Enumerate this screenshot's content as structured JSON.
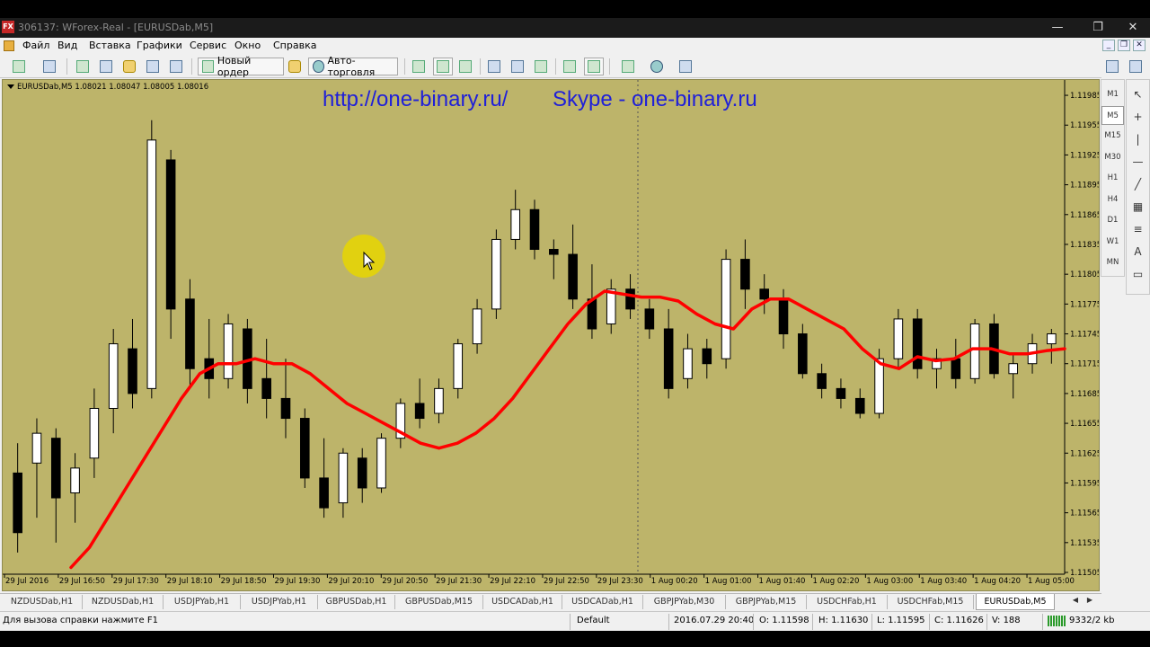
{
  "window": {
    "app_icon_text": "FX",
    "title": "306137: WForex-Real - [EURUSDab,M5]",
    "min": "—",
    "restore": "❐",
    "close": "✕"
  },
  "menu": {
    "items": [
      "Файл",
      "Вид",
      "Вставка",
      "Графики",
      "Сервис",
      "Окно",
      "Справка"
    ],
    "mdi_min": "_",
    "mdi_restore": "❐",
    "mdi_close": "✕"
  },
  "toolbar": {
    "new_order_label": "Новый ордер",
    "autotrading_label": "Авто-торговля"
  },
  "chart": {
    "header": "EURUSDab,M5  1.08021 1.08047 1.08005 1.08016",
    "watermark_left": "http://one-binary.ru/",
    "watermark_right": "Skype - one-binary.ru",
    "background_color": "#bdb46a",
    "candle_up_color": "#ffffff",
    "candle_down_color": "#000000",
    "ma_color": "#ff0000"
  },
  "chart_data": {
    "type": "candlestick",
    "symbol": "EURUSDab",
    "timeframe": "M5",
    "price_ticks": [
      "1.11985",
      "1.11955",
      "1.11925",
      "1.11895",
      "1.11865",
      "1.11835",
      "1.11805",
      "1.11775",
      "1.11745",
      "1.11715",
      "1.11685",
      "1.11655",
      "1.11625",
      "1.11595",
      "1.11565",
      "1.11535",
      "1.11505"
    ],
    "ylim": [
      1.11505,
      1.11995
    ],
    "time_ticks": [
      "29 Jul 2016",
      "29 Jul 16:50",
      "29 Jul 17:30",
      "29 Jul 18:10",
      "29 Jul 18:50",
      "29 Jul 19:30",
      "29 Jul 20:10",
      "29 Jul 20:50",
      "29 Jul 21:30",
      "29 Jul 22:10",
      "29 Jul 22:50",
      "29 Jul 23:30",
      "1 Aug 00:20",
      "1 Aug 01:00",
      "1 Aug 01:40",
      "1 Aug 02:20",
      "1 Aug 03:00",
      "1 Aug 03:40",
      "1 Aug 04:20",
      "1 Aug 05:00"
    ],
    "ma_series": {
      "name": "",
      "values": [
        1.1151,
        1.1153,
        1.1156,
        1.1159,
        1.1162,
        1.1165,
        1.1168,
        1.11705,
        1.11715,
        1.11715,
        1.1172,
        1.11715,
        1.11715,
        1.11705,
        1.1169,
        1.11675,
        1.11665,
        1.11655,
        1.11645,
        1.11635,
        1.1163,
        1.11635,
        1.11645,
        1.1166,
        1.1168,
        1.11705,
        1.1173,
        1.11755,
        1.11775,
        1.11788,
        1.11785,
        1.11782,
        1.11782,
        1.11778,
        1.11765,
        1.11755,
        1.1175,
        1.1177,
        1.1178,
        1.1178,
        1.1177,
        1.1176,
        1.1175,
        1.1173,
        1.11715,
        1.1171,
        1.11722,
        1.11718,
        1.1172,
        1.1173,
        1.1173,
        1.11725,
        1.11725,
        1.11728,
        1.1173
      ]
    },
    "candles": [
      {
        "o": 1.11605,
        "h": 1.11635,
        "l": 1.11525,
        "c": 1.11545
      },
      {
        "o": 1.11615,
        "h": 1.1166,
        "l": 1.1156,
        "c": 1.11645
      },
      {
        "o": 1.1164,
        "h": 1.1165,
        "l": 1.11535,
        "c": 1.1158
      },
      {
        "o": 1.11585,
        "h": 1.11625,
        "l": 1.11555,
        "c": 1.1161
      },
      {
        "o": 1.1162,
        "h": 1.1169,
        "l": 1.116,
        "c": 1.1167
      },
      {
        "o": 1.1167,
        "h": 1.1175,
        "l": 1.11645,
        "c": 1.11735
      },
      {
        "o": 1.1173,
        "h": 1.1176,
        "l": 1.1167,
        "c": 1.11685
      },
      {
        "o": 1.1169,
        "h": 1.1196,
        "l": 1.1168,
        "c": 1.1194
      },
      {
        "o": 1.1192,
        "h": 1.1193,
        "l": 1.1174,
        "c": 1.1177
      },
      {
        "o": 1.1178,
        "h": 1.118,
        "l": 1.1169,
        "c": 1.1171
      },
      {
        "o": 1.1172,
        "h": 1.1176,
        "l": 1.1168,
        "c": 1.117
      },
      {
        "o": 1.117,
        "h": 1.11765,
        "l": 1.1169,
        "c": 1.11755
      },
      {
        "o": 1.1175,
        "h": 1.1176,
        "l": 1.11675,
        "c": 1.1169
      },
      {
        "o": 1.117,
        "h": 1.1174,
        "l": 1.1166,
        "c": 1.1168
      },
      {
        "o": 1.1168,
        "h": 1.1172,
        "l": 1.1164,
        "c": 1.1166
      },
      {
        "o": 1.1166,
        "h": 1.1167,
        "l": 1.1159,
        "c": 1.116
      },
      {
        "o": 1.116,
        "h": 1.1164,
        "l": 1.1156,
        "c": 1.1157
      },
      {
        "o": 1.11575,
        "h": 1.1163,
        "l": 1.1156,
        "c": 1.11625
      },
      {
        "o": 1.1162,
        "h": 1.1163,
        "l": 1.11575,
        "c": 1.1159
      },
      {
        "o": 1.1159,
        "h": 1.11645,
        "l": 1.11585,
        "c": 1.1164
      },
      {
        "o": 1.1164,
        "h": 1.1168,
        "l": 1.1163,
        "c": 1.11675
      },
      {
        "o": 1.11675,
        "h": 1.117,
        "l": 1.1165,
        "c": 1.1166
      },
      {
        "o": 1.11665,
        "h": 1.117,
        "l": 1.11655,
        "c": 1.1169
      },
      {
        "o": 1.1169,
        "h": 1.1174,
        "l": 1.1168,
        "c": 1.11735
      },
      {
        "o": 1.11735,
        "h": 1.1178,
        "l": 1.11725,
        "c": 1.1177
      },
      {
        "o": 1.1177,
        "h": 1.1185,
        "l": 1.1176,
        "c": 1.1184
      },
      {
        "o": 1.1184,
        "h": 1.1189,
        "l": 1.1183,
        "c": 1.1187
      },
      {
        "o": 1.1187,
        "h": 1.1188,
        "l": 1.1182,
        "c": 1.1183
      },
      {
        "o": 1.1183,
        "h": 1.1184,
        "l": 1.118,
        "c": 1.11825
      },
      {
        "o": 1.11825,
        "h": 1.11855,
        "l": 1.1177,
        "c": 1.1178
      },
      {
        "o": 1.1178,
        "h": 1.11815,
        "l": 1.1174,
        "c": 1.1175
      },
      {
        "o": 1.11755,
        "h": 1.118,
        "l": 1.11745,
        "c": 1.1179
      },
      {
        "o": 1.1179,
        "h": 1.11805,
        "l": 1.1176,
        "c": 1.1177
      },
      {
        "o": 1.1177,
        "h": 1.1178,
        "l": 1.1174,
        "c": 1.1175
      },
      {
        "o": 1.1175,
        "h": 1.1177,
        "l": 1.1168,
        "c": 1.1169
      },
      {
        "o": 1.117,
        "h": 1.11745,
        "l": 1.1169,
        "c": 1.1173
      },
      {
        "o": 1.1173,
        "h": 1.1174,
        "l": 1.117,
        "c": 1.11715
      },
      {
        "o": 1.1172,
        "h": 1.1183,
        "l": 1.1171,
        "c": 1.1182
      },
      {
        "o": 1.1182,
        "h": 1.1184,
        "l": 1.1177,
        "c": 1.1179
      },
      {
        "o": 1.1179,
        "h": 1.11805,
        "l": 1.11765,
        "c": 1.1178
      },
      {
        "o": 1.1178,
        "h": 1.1179,
        "l": 1.1173,
        "c": 1.11745
      },
      {
        "o": 1.11745,
        "h": 1.11755,
        "l": 1.117,
        "c": 1.11705
      },
      {
        "o": 1.11705,
        "h": 1.11715,
        "l": 1.1168,
        "c": 1.1169
      },
      {
        "o": 1.1169,
        "h": 1.117,
        "l": 1.1167,
        "c": 1.1168
      },
      {
        "o": 1.1168,
        "h": 1.1169,
        "l": 1.1166,
        "c": 1.11665
      },
      {
        "o": 1.11665,
        "h": 1.1173,
        "l": 1.1166,
        "c": 1.1172
      },
      {
        "o": 1.1172,
        "h": 1.1177,
        "l": 1.1171,
        "c": 1.1176
      },
      {
        "o": 1.1176,
        "h": 1.1177,
        "l": 1.117,
        "c": 1.1171
      },
      {
        "o": 1.1171,
        "h": 1.1173,
        "l": 1.1169,
        "c": 1.1172
      },
      {
        "o": 1.1172,
        "h": 1.1174,
        "l": 1.1169,
        "c": 1.117
      },
      {
        "o": 1.117,
        "h": 1.1176,
        "l": 1.11695,
        "c": 1.11755
      },
      {
        "o": 1.11755,
        "h": 1.11765,
        "l": 1.117,
        "c": 1.11705
      },
      {
        "o": 1.11705,
        "h": 1.11725,
        "l": 1.1168,
        "c": 1.11715
      },
      {
        "o": 1.11715,
        "h": 1.11745,
        "l": 1.11705,
        "c": 1.11735
      },
      {
        "o": 1.11735,
        "h": 1.1175,
        "l": 1.11715,
        "c": 1.11745
      }
    ]
  },
  "right_panel": {
    "timeframes": [
      "M1",
      "M5",
      "M15",
      "M30",
      "H1",
      "H4",
      "D1",
      "W1",
      "MN"
    ],
    "active": "M5"
  },
  "tabs": {
    "items": [
      "NZDUSDab,H1",
      "NZDUSDab,H1",
      "USDJPYab,H1",
      "USDJPYab,H1",
      "GBPUSDab,H1",
      "GBPUSDab,M15",
      "USDCADab,H1",
      "USDCADab,H1",
      "GBPJPYab,M30",
      "GBPJPYab,M15",
      "USDCHFab,H1",
      "USDCHFab,M15",
      "EURUSDab,M5"
    ],
    "active": "EURUSDab,M5"
  },
  "status": {
    "help": "Для вызова справки нажмите F1",
    "profile": "Default",
    "datetime": "2016.07.29 20:40",
    "open": "O: 1.11598",
    "high": "H: 1.11630",
    "low": "L: 1.11595",
    "close": "C: 1.11626",
    "volume": "V: 188",
    "traffic": "9332/2 kb"
  }
}
